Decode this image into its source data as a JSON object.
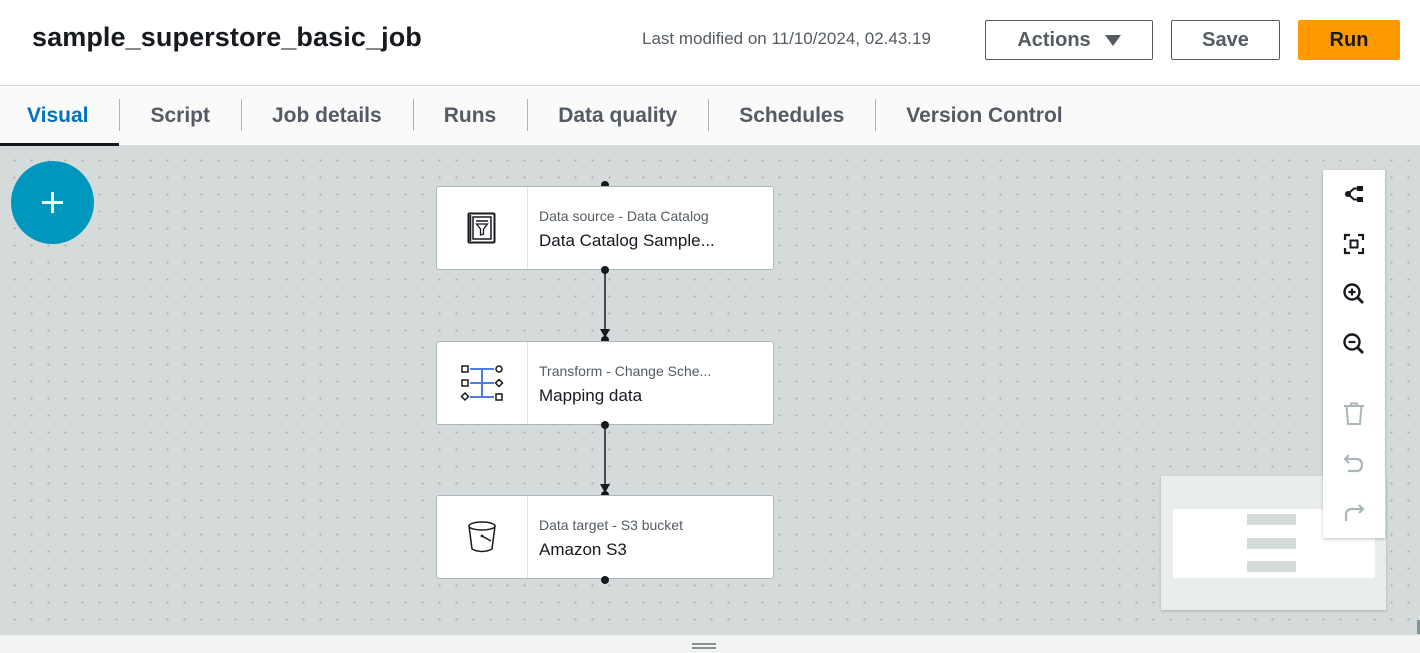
{
  "header": {
    "job_title": "sample_superstore_basic_job",
    "last_modified": "Last modified on 11/10/2024, 02.43.19",
    "actions_label": "Actions",
    "save_label": "Save",
    "run_label": "Run"
  },
  "tabs": [
    {
      "label": "Visual",
      "active": true
    },
    {
      "label": "Script"
    },
    {
      "label": "Job details"
    },
    {
      "label": "Runs"
    },
    {
      "label": "Data quality"
    },
    {
      "label": "Schedules"
    },
    {
      "label": "Version Control"
    }
  ],
  "canvas": {
    "add_button_icon": "plus-icon",
    "nodes": [
      {
        "type_label": "Data source - Data Catalog",
        "name": "Data Catalog Sample...",
        "icon": "data-catalog-icon"
      },
      {
        "type_label": "Transform - Change Sche...",
        "name": "Mapping data",
        "icon": "change-schema-icon"
      },
      {
        "type_label": "Data target - S3 bucket",
        "name": "Amazon S3",
        "icon": "s3-bucket-icon"
      }
    ],
    "toolbar": [
      "layout-icon",
      "fit-view-icon",
      "zoom-in-icon",
      "zoom-out-icon",
      "delete-icon",
      "undo-icon",
      "redo-icon"
    ]
  },
  "colors": {
    "accent": "#0073bb",
    "run_button": "#ff9900",
    "add_button": "#0097bf",
    "canvas": "#d5dbdb"
  }
}
